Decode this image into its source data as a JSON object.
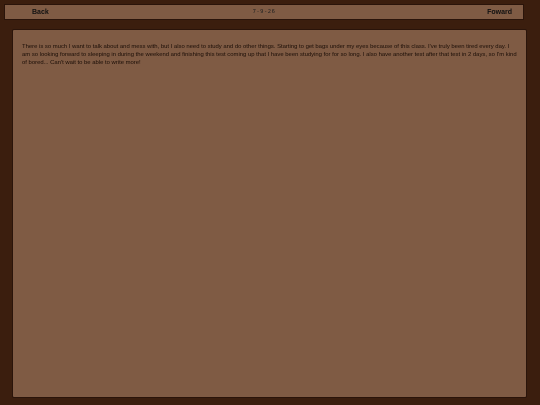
{
  "topbar": {
    "back_label": "Back",
    "date": "7-9-26",
    "forward_label": "Foward"
  },
  "entry": {
    "text": "There is so much I want to talk about and mess with, but I also need to study and do other things. Starting to get bags under my eyes because of this class. I've truly been tired every day. I am so looking forward to sleeping in during the weekend and finishing this test coming up that I have been studying for for so long. I also have another test after that test in 2 days, so I'm kind of bored... Can't wait to be able to write more!"
  },
  "colors": {
    "background": "#3b1e0e",
    "panel": "#7f5b44",
    "border": "#2a140a",
    "text": "#1a0d06"
  }
}
